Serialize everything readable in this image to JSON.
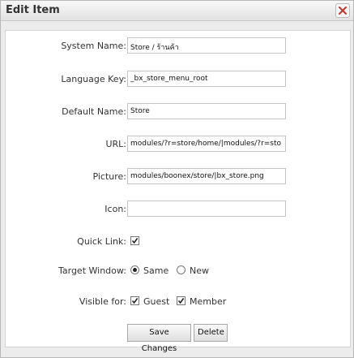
{
  "dialog": {
    "title": "Edit Item",
    "close_icon": "close-icon"
  },
  "form": {
    "system_name": {
      "label": "System Name:",
      "value": "Store / ร้านค้า"
    },
    "language_key": {
      "label": "Language Key:",
      "value": "_bx_store_menu_root"
    },
    "default_name": {
      "label": "Default Name:",
      "value": "Store"
    },
    "url": {
      "label": "URL:",
      "value": "modules/?r=store/home/|modules/?r=sto"
    },
    "picture": {
      "label": "Picture:",
      "value": "modules/boonex/store/|bx_store.png"
    },
    "icon": {
      "label": "Icon:",
      "value": ""
    },
    "quick_link": {
      "label": "Quick Link:",
      "checked": true
    },
    "target_window": {
      "label": "Target Window:",
      "options": [
        "Same",
        "New"
      ],
      "selected": "Same"
    },
    "visible_for": {
      "label": "Visible for:",
      "options": [
        "Guest",
        "Member"
      ],
      "checked": [
        true,
        true
      ]
    }
  },
  "buttons": {
    "save_label": "Save Changes",
    "delete_label": "Delete"
  }
}
